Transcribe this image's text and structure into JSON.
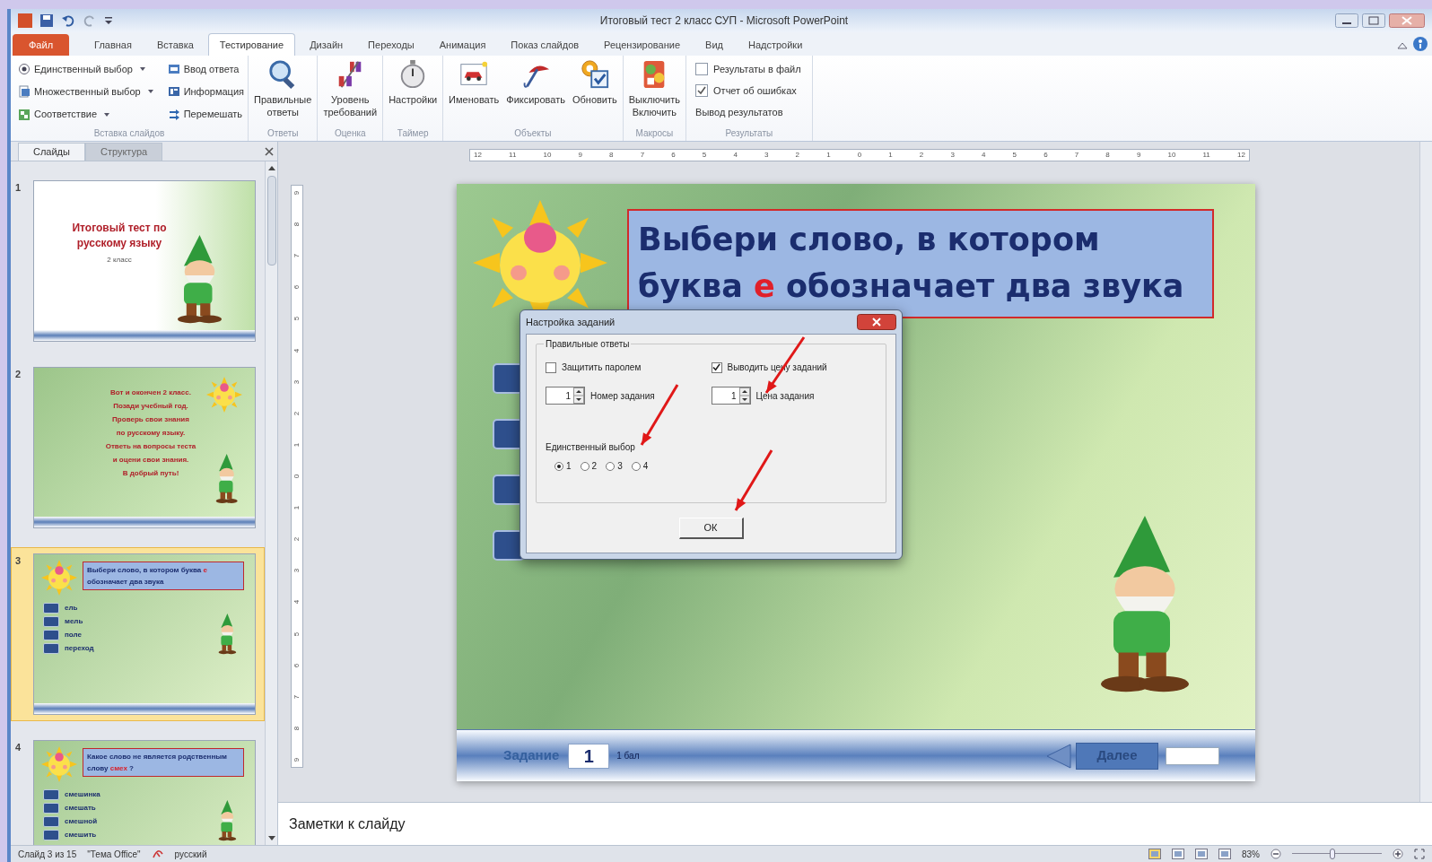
{
  "window": {
    "title": "Итоговый тест 2 класс СУП - Microsoft PowerPoint"
  },
  "ribbon_tabs": [
    {
      "label": "Файл",
      "kind": "file",
      "selected": false
    },
    {
      "label": "Главная",
      "kind": "tab",
      "selected": false
    },
    {
      "label": "Вставка",
      "kind": "tab",
      "selected": false
    },
    {
      "label": "Тестирование",
      "kind": "tab",
      "selected": true
    },
    {
      "label": "Дизайн",
      "kind": "tab",
      "selected": false
    },
    {
      "label": "Переходы",
      "kind": "tab",
      "selected": false
    },
    {
      "label": "Анимация",
      "kind": "tab",
      "selected": false
    },
    {
      "label": "Показ слайдов",
      "kind": "tab",
      "selected": false
    },
    {
      "label": "Рецензирование",
      "kind": "tab",
      "selected": false
    },
    {
      "label": "Вид",
      "kind": "tab",
      "selected": false
    },
    {
      "label": "Надстройки",
      "kind": "tab",
      "selected": false
    }
  ],
  "ribbon_groups": [
    {
      "label": "Вставка слайдов",
      "kind": "small",
      "items": [
        {
          "label": "Единственный выбор",
          "dropdown": true
        },
        {
          "label": "Множественный выбор",
          "dropdown": true
        },
        {
          "label": "Соответствие",
          "dropdown": true
        },
        {
          "label": "Ввод ответа",
          "dropdown": false
        },
        {
          "label": "Информация",
          "dropdown": false
        },
        {
          "label": "Перемешать",
          "dropdown": false
        }
      ]
    },
    {
      "label": "Ответы",
      "kind": "large",
      "items": [
        {
          "lines": [
            "Правильные",
            "ответы"
          ]
        }
      ]
    },
    {
      "label": "Оценка",
      "kind": "large",
      "items": [
        {
          "lines": [
            "Уровень",
            "требований"
          ]
        }
      ]
    },
    {
      "label": "Таймер",
      "kind": "large",
      "items": [
        {
          "lines": [
            "Настройки"
          ]
        }
      ]
    },
    {
      "label": "Объекты",
      "kind": "large",
      "items": [
        {
          "lines": [
            "Именовать"
          ]
        },
        {
          "lines": [
            "Фиксировать"
          ]
        },
        {
          "lines": [
            "Обновить"
          ]
        }
      ]
    },
    {
      "label": "Макросы",
      "kind": "large",
      "items": [
        {
          "lines": [
            "Выключить",
            "Включить"
          ]
        }
      ]
    },
    {
      "label": "Результаты",
      "kind": "checks",
      "items": [
        {
          "kind": "check",
          "label": "Результаты в файл",
          "checked": false
        },
        {
          "kind": "check",
          "label": "Отчет об ошибках",
          "checked": true
        },
        {
          "kind": "text",
          "label": "Вывод результатов"
        }
      ]
    }
  ],
  "side_pane": {
    "tabs": [
      {
        "label": "Слайды",
        "selected": true
      },
      {
        "label": "Структура",
        "selected": false
      }
    ],
    "slides": [
      {
        "number": "1",
        "selected": false,
        "kind": "title",
        "title": "Итоговый тест по русскому языку",
        "subtitle": "2 класс"
      },
      {
        "number": "2",
        "selected": false,
        "kind": "text",
        "lines": [
          "Вот и окончен 2 класс.",
          "Позади учебный год.",
          "Проверь свои знания",
          "по русскому языку.",
          "Ответь на вопросы теста",
          "и оцени свои знания.",
          "В добрый путь!"
        ]
      },
      {
        "number": "3",
        "selected": true,
        "kind": "question",
        "question_parts": [
          {
            "text": "Выбери слово, в котором буква ",
            "highlight": false
          },
          {
            "text": "е",
            "highlight": true
          },
          {
            "text": " обозначает два звука",
            "highlight": false
          }
        ],
        "answers": [
          "ель",
          "мель",
          "поле",
          "переход"
        ]
      },
      {
        "number": "4",
        "selected": false,
        "kind": "question",
        "question_parts": [
          {
            "text": "Какое слово не является родственным слову ",
            "highlight": false
          },
          {
            "text": "смех",
            "highlight": true
          },
          {
            "text": " ?",
            "highlight": false
          }
        ],
        "answers": [
          "смешинка",
          "смешать",
          "смешной",
          "смешить"
        ]
      }
    ]
  },
  "rulers": {
    "horizontal": [
      "12",
      "11",
      "10",
      "9",
      "8",
      "7",
      "6",
      "5",
      "4",
      "3",
      "2",
      "1",
      "0",
      "1",
      "2",
      "3",
      "4",
      "5",
      "6",
      "7",
      "8",
      "9",
      "10",
      "11",
      "12"
    ],
    "vertical": [
      "9",
      "8",
      "7",
      "6",
      "5",
      "4",
      "3",
      "2",
      "1",
      "0",
      "1",
      "2",
      "3",
      "4",
      "5",
      "6",
      "7",
      "8",
      "9"
    ]
  },
  "slide": {
    "title_parts": [
      {
        "text": "Выбери слово, в котором буква ",
        "highlight": false
      },
      {
        "text": "е",
        "highlight": true
      },
      {
        "text": " обозначает два звука",
        "highlight": false
      }
    ],
    "footer": {
      "task_label": "Задание",
      "task_number": "1",
      "points": "1 бал",
      "next": "Далее"
    }
  },
  "dialog": {
    "title": "Настройка заданий",
    "group": "Правильные ответы",
    "checks": [
      {
        "label": "Защитить паролем",
        "checked": false
      },
      {
        "label": "Выводить цену заданий",
        "checked": true
      }
    ],
    "spinners": [
      {
        "value": "1",
        "label": "Номер задания"
      },
      {
        "value": "1",
        "label": "Цена задания"
      }
    ],
    "choice_label": "Единственный выбор",
    "options": [
      {
        "label": "1",
        "selected": true
      },
      {
        "label": "2",
        "selected": false
      },
      {
        "label": "3",
        "selected": false
      },
      {
        "label": "4",
        "selected": false
      }
    ],
    "ok": "ОК"
  },
  "notes": {
    "placeholder": "Заметки к слайду"
  },
  "status_bar": {
    "slide": "Слайд 3 из 15",
    "theme": "\"Тема Office\"",
    "language": "русский",
    "zoom": "83%",
    "zoom_slider": {
      "level": 0.45
    }
  }
}
